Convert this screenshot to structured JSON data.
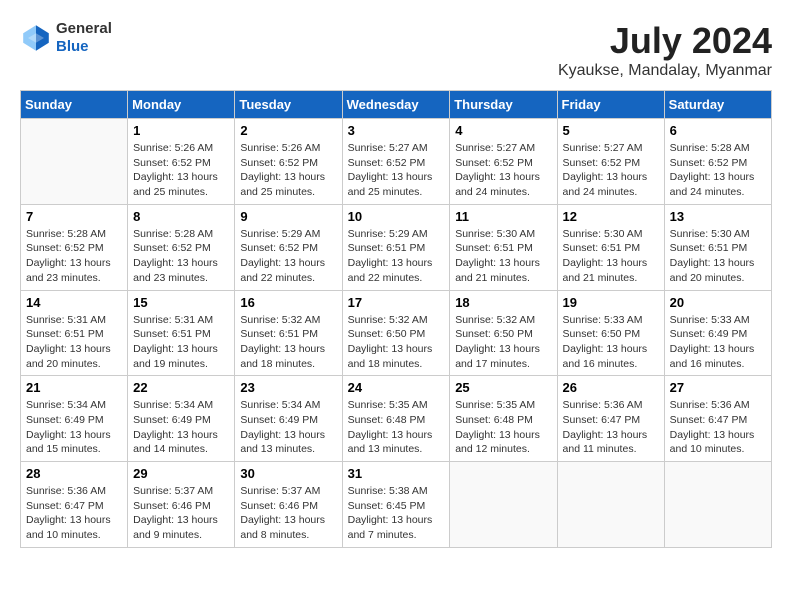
{
  "header": {
    "logo_line1": "General",
    "logo_line2": "Blue",
    "title": "July 2024",
    "location": "Kyaukse, Mandalay, Myanmar"
  },
  "calendar": {
    "days_of_week": [
      "Sunday",
      "Monday",
      "Tuesday",
      "Wednesday",
      "Thursday",
      "Friday",
      "Saturday"
    ],
    "weeks": [
      [
        {
          "day": "",
          "info": ""
        },
        {
          "day": "1",
          "info": "Sunrise: 5:26 AM\nSunset: 6:52 PM\nDaylight: 13 hours\nand 25 minutes."
        },
        {
          "day": "2",
          "info": "Sunrise: 5:26 AM\nSunset: 6:52 PM\nDaylight: 13 hours\nand 25 minutes."
        },
        {
          "day": "3",
          "info": "Sunrise: 5:27 AM\nSunset: 6:52 PM\nDaylight: 13 hours\nand 25 minutes."
        },
        {
          "day": "4",
          "info": "Sunrise: 5:27 AM\nSunset: 6:52 PM\nDaylight: 13 hours\nand 24 minutes."
        },
        {
          "day": "5",
          "info": "Sunrise: 5:27 AM\nSunset: 6:52 PM\nDaylight: 13 hours\nand 24 minutes."
        },
        {
          "day": "6",
          "info": "Sunrise: 5:28 AM\nSunset: 6:52 PM\nDaylight: 13 hours\nand 24 minutes."
        }
      ],
      [
        {
          "day": "7",
          "info": "Sunrise: 5:28 AM\nSunset: 6:52 PM\nDaylight: 13 hours\nand 23 minutes."
        },
        {
          "day": "8",
          "info": "Sunrise: 5:28 AM\nSunset: 6:52 PM\nDaylight: 13 hours\nand 23 minutes."
        },
        {
          "day": "9",
          "info": "Sunrise: 5:29 AM\nSunset: 6:52 PM\nDaylight: 13 hours\nand 22 minutes."
        },
        {
          "day": "10",
          "info": "Sunrise: 5:29 AM\nSunset: 6:51 PM\nDaylight: 13 hours\nand 22 minutes."
        },
        {
          "day": "11",
          "info": "Sunrise: 5:30 AM\nSunset: 6:51 PM\nDaylight: 13 hours\nand 21 minutes."
        },
        {
          "day": "12",
          "info": "Sunrise: 5:30 AM\nSunset: 6:51 PM\nDaylight: 13 hours\nand 21 minutes."
        },
        {
          "day": "13",
          "info": "Sunrise: 5:30 AM\nSunset: 6:51 PM\nDaylight: 13 hours\nand 20 minutes."
        }
      ],
      [
        {
          "day": "14",
          "info": "Sunrise: 5:31 AM\nSunset: 6:51 PM\nDaylight: 13 hours\nand 20 minutes."
        },
        {
          "day": "15",
          "info": "Sunrise: 5:31 AM\nSunset: 6:51 PM\nDaylight: 13 hours\nand 19 minutes."
        },
        {
          "day": "16",
          "info": "Sunrise: 5:32 AM\nSunset: 6:51 PM\nDaylight: 13 hours\nand 18 minutes."
        },
        {
          "day": "17",
          "info": "Sunrise: 5:32 AM\nSunset: 6:50 PM\nDaylight: 13 hours\nand 18 minutes."
        },
        {
          "day": "18",
          "info": "Sunrise: 5:32 AM\nSunset: 6:50 PM\nDaylight: 13 hours\nand 17 minutes."
        },
        {
          "day": "19",
          "info": "Sunrise: 5:33 AM\nSunset: 6:50 PM\nDaylight: 13 hours\nand 16 minutes."
        },
        {
          "day": "20",
          "info": "Sunrise: 5:33 AM\nSunset: 6:49 PM\nDaylight: 13 hours\nand 16 minutes."
        }
      ],
      [
        {
          "day": "21",
          "info": "Sunrise: 5:34 AM\nSunset: 6:49 PM\nDaylight: 13 hours\nand 15 minutes."
        },
        {
          "day": "22",
          "info": "Sunrise: 5:34 AM\nSunset: 6:49 PM\nDaylight: 13 hours\nand 14 minutes."
        },
        {
          "day": "23",
          "info": "Sunrise: 5:34 AM\nSunset: 6:49 PM\nDaylight: 13 hours\nand 13 minutes."
        },
        {
          "day": "24",
          "info": "Sunrise: 5:35 AM\nSunset: 6:48 PM\nDaylight: 13 hours\nand 13 minutes."
        },
        {
          "day": "25",
          "info": "Sunrise: 5:35 AM\nSunset: 6:48 PM\nDaylight: 13 hours\nand 12 minutes."
        },
        {
          "day": "26",
          "info": "Sunrise: 5:36 AM\nSunset: 6:47 PM\nDaylight: 13 hours\nand 11 minutes."
        },
        {
          "day": "27",
          "info": "Sunrise: 5:36 AM\nSunset: 6:47 PM\nDaylight: 13 hours\nand 10 minutes."
        }
      ],
      [
        {
          "day": "28",
          "info": "Sunrise: 5:36 AM\nSunset: 6:47 PM\nDaylight: 13 hours\nand 10 minutes."
        },
        {
          "day": "29",
          "info": "Sunrise: 5:37 AM\nSunset: 6:46 PM\nDaylight: 13 hours\nand 9 minutes."
        },
        {
          "day": "30",
          "info": "Sunrise: 5:37 AM\nSunset: 6:46 PM\nDaylight: 13 hours\nand 8 minutes."
        },
        {
          "day": "31",
          "info": "Sunrise: 5:38 AM\nSunset: 6:45 PM\nDaylight: 13 hours\nand 7 minutes."
        },
        {
          "day": "",
          "info": ""
        },
        {
          "day": "",
          "info": ""
        },
        {
          "day": "",
          "info": ""
        }
      ]
    ]
  }
}
